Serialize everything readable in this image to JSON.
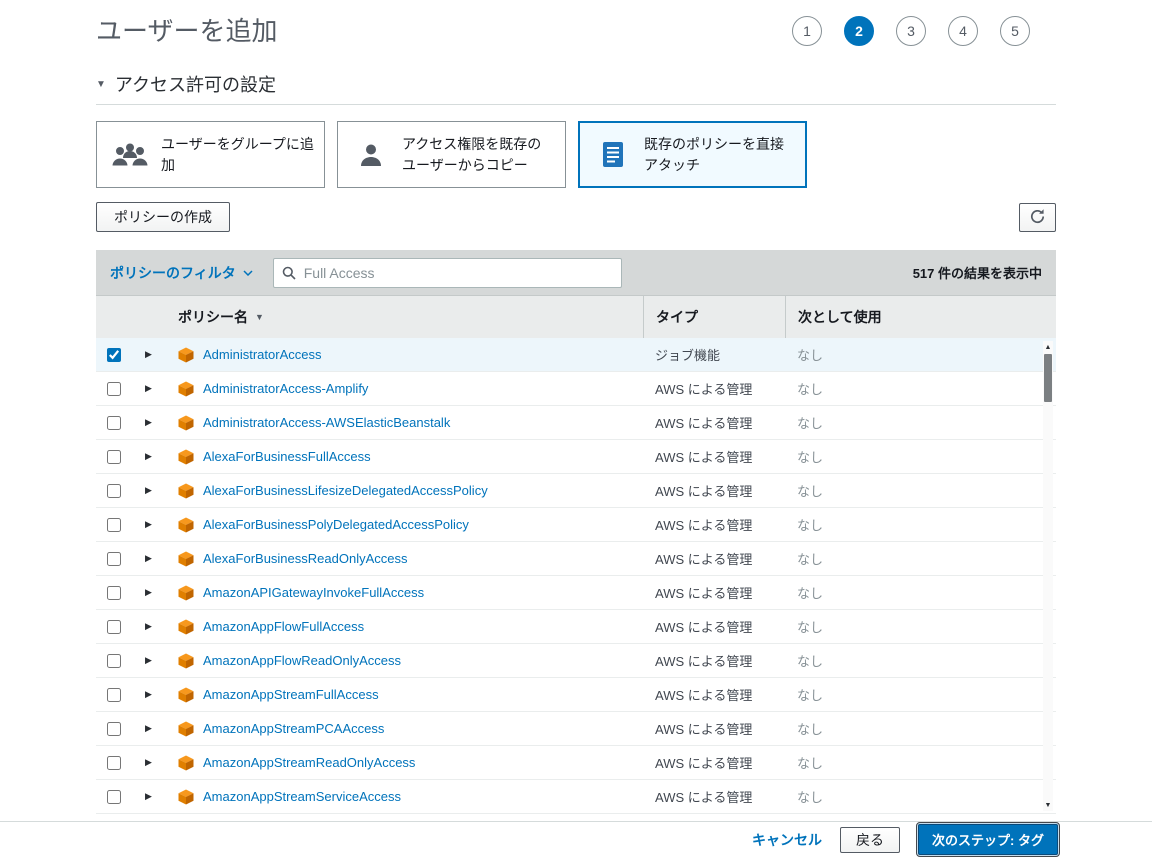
{
  "page": {
    "title": "ユーザーを追加"
  },
  "steps": {
    "labels": [
      "1",
      "2",
      "3",
      "4",
      "5"
    ],
    "active_index": 1
  },
  "permissions_section": {
    "title": "アクセス許可の設定"
  },
  "permission_options": [
    {
      "label": "ユーザーをグループに追加",
      "icon": "user-group-icon",
      "selected": false
    },
    {
      "label": "アクセス権限を既存のユーザーからコピー",
      "icon": "user-copy-icon",
      "selected": false
    },
    {
      "label": "既存のポリシーを直接アタッチ",
      "icon": "policy-document-icon",
      "selected": true
    }
  ],
  "toolbar": {
    "create_policy_label": "ポリシーの作成",
    "refresh_icon": "refresh-icon"
  },
  "filter_bar": {
    "filter_label": "ポリシーのフィルタ",
    "search_placeholder": "Full Access",
    "results_text": "517 件の結果を表示中"
  },
  "policy_table": {
    "columns": {
      "name": "ポリシー名",
      "type": "タイプ",
      "used_as": "次として使用"
    },
    "rows": [
      {
        "name": "AdministratorAccess",
        "type": "ジョブ機能",
        "used_as": "なし",
        "checked": true
      },
      {
        "name": "AdministratorAccess-Amplify",
        "type": "AWS による管理",
        "used_as": "なし",
        "checked": false
      },
      {
        "name": "AdministratorAccess-AWSElasticBeanstalk",
        "type": "AWS による管理",
        "used_as": "なし",
        "checked": false
      },
      {
        "name": "AlexaForBusinessFullAccess",
        "type": "AWS による管理",
        "used_as": "なし",
        "checked": false
      },
      {
        "name": "AlexaForBusinessLifesizeDelegatedAccessPolicy",
        "type": "AWS による管理",
        "used_as": "なし",
        "checked": false
      },
      {
        "name": "AlexaForBusinessPolyDelegatedAccessPolicy",
        "type": "AWS による管理",
        "used_as": "なし",
        "checked": false
      },
      {
        "name": "AlexaForBusinessReadOnlyAccess",
        "type": "AWS による管理",
        "used_as": "なし",
        "checked": false
      },
      {
        "name": "AmazonAPIGatewayInvokeFullAccess",
        "type": "AWS による管理",
        "used_as": "なし",
        "checked": false
      },
      {
        "name": "AmazonAppFlowFullAccess",
        "type": "AWS による管理",
        "used_as": "なし",
        "checked": false
      },
      {
        "name": "AmazonAppFlowReadOnlyAccess",
        "type": "AWS による管理",
        "used_as": "なし",
        "checked": false
      },
      {
        "name": "AmazonAppStreamFullAccess",
        "type": "AWS による管理",
        "used_as": "なし",
        "checked": false
      },
      {
        "name": "AmazonAppStreamPCAAccess",
        "type": "AWS による管理",
        "used_as": "なし",
        "checked": false
      },
      {
        "name": "AmazonAppStreamReadOnlyAccess",
        "type": "AWS による管理",
        "used_as": "なし",
        "checked": false
      },
      {
        "name": "AmazonAppStreamServiceAccess",
        "type": "AWS による管理",
        "used_as": "なし",
        "checked": false
      }
    ]
  },
  "footer": {
    "cancel_label": "キャンセル",
    "back_label": "戻る",
    "next_label": "次のステップ: タグ"
  },
  "colors": {
    "accent_blue": "#0073bb",
    "selected_row_bg": "#edf6fb",
    "policy_icon_orange": "#e07f00",
    "filter_bar_gray": "#d5d8d8",
    "header_row_gray": "#eaecec"
  }
}
